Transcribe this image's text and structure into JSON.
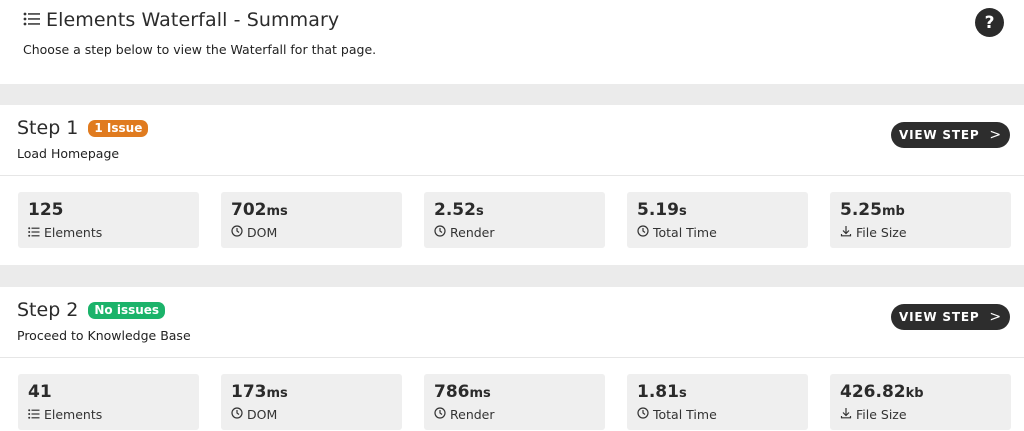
{
  "header": {
    "title": "Elements Waterfall - Summary",
    "subtitle": "Choose a step below to view the Waterfall for that page.",
    "help_label": "?"
  },
  "colors": {
    "issue_badge": "#e07b1f",
    "ok_badge": "#1bb36a",
    "button_bg": "#2d2d2d"
  },
  "steps": [
    {
      "title": "Step 1",
      "badge": "1 Issue",
      "badge_status": "issue",
      "description": "Load Homepage",
      "button": "VIEW STEP",
      "metrics": [
        {
          "value": "125",
          "unit": "",
          "label": "Elements",
          "icon": "list-icon"
        },
        {
          "value": "702",
          "unit": "ms",
          "label": "DOM",
          "icon": "clock-icon"
        },
        {
          "value": "2.52",
          "unit": "s",
          "label": "Render",
          "icon": "clock-icon"
        },
        {
          "value": "5.19",
          "unit": "s",
          "label": "Total Time",
          "icon": "clock-icon"
        },
        {
          "value": "5.25",
          "unit": "mb",
          "label": "File Size",
          "icon": "download-icon"
        }
      ]
    },
    {
      "title": "Step 2",
      "badge": "No issues",
      "badge_status": "ok",
      "description": "Proceed to Knowledge Base",
      "button": "VIEW STEP",
      "metrics": [
        {
          "value": "41",
          "unit": "",
          "label": "Elements",
          "icon": "list-icon"
        },
        {
          "value": "173",
          "unit": "ms",
          "label": "DOM",
          "icon": "clock-icon"
        },
        {
          "value": "786",
          "unit": "ms",
          "label": "Render",
          "icon": "clock-icon"
        },
        {
          "value": "1.81",
          "unit": "s",
          "label": "Total Time",
          "icon": "clock-icon"
        },
        {
          "value": "426.82",
          "unit": "kb",
          "label": "File Size",
          "icon": "download-icon"
        }
      ]
    }
  ]
}
